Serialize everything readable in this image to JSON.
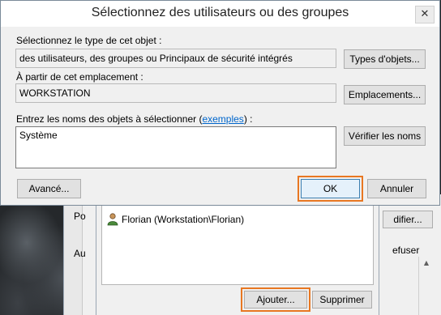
{
  "dialog": {
    "title": "Sélectionnez des utilisateurs ou des groupes",
    "close_symbol": "✕",
    "object_type_label": "Sélectionnez le type de cet objet :",
    "object_type_value": "des utilisateurs, des groupes ou Principaux de sécurité intégrés",
    "object_types_button": "Types d'objets...",
    "location_label": "À partir de cet emplacement :",
    "location_value": "WORKSTATION",
    "locations_button": "Emplacements...",
    "names_label_prefix": "Entrez les noms des objets à sélectionner (",
    "names_label_link": "exemples",
    "names_label_suffix": ") :",
    "names_value": "Système",
    "check_names_button": "Vérifier les noms",
    "advanced_button": "Avancé...",
    "ok_button": "OK",
    "cancel_button": "Annuler"
  },
  "background": {
    "label_po": "Po",
    "label_au": "Au",
    "modify_button_partial": "difier...",
    "deny_label_partial": "efuser",
    "list_item": "Florian (Workstation\\Florian)",
    "add_button": "Ajouter...",
    "remove_button": "Supprimer"
  },
  "colors": {
    "highlight": "#e87722",
    "link": "#0066cc"
  },
  "icons": {
    "user": "user-icon",
    "close": "close-icon",
    "scroll_up": "scroll-up-arrow-icon",
    "scroll_down": "scroll-down-arrow-icon"
  }
}
